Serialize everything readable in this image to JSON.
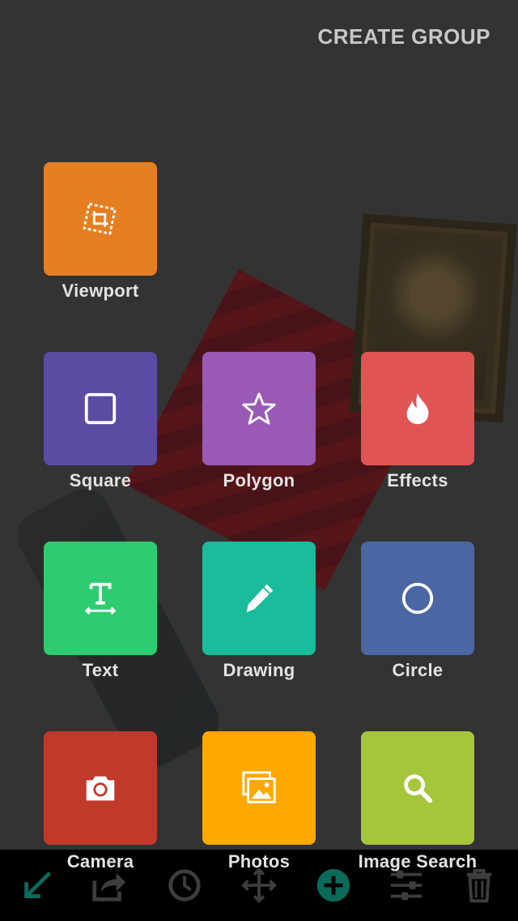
{
  "header": {
    "title": "CREATE GROUP"
  },
  "menu": {
    "items": [
      {
        "label": "Viewport",
        "icon": "crop-icon",
        "color": "#E67E22"
      },
      {
        "label": "Square",
        "icon": "square-icon",
        "color": "#5B4BA3"
      },
      {
        "label": "Polygon",
        "icon": "star-icon",
        "color": "#9B59B6"
      },
      {
        "label": "Effects",
        "icon": "fire-icon",
        "color": "#E05454"
      },
      {
        "label": "Text",
        "icon": "text-icon",
        "color": "#2ECC71"
      },
      {
        "label": "Drawing",
        "icon": "pencil-icon",
        "color": "#1ABC9C"
      },
      {
        "label": "Circle",
        "icon": "circle-icon",
        "color": "#4A67A3"
      },
      {
        "label": "Camera",
        "icon": "camera-icon",
        "color": "#C0392B"
      },
      {
        "label": "Photos",
        "icon": "photos-icon",
        "color": "#FFA800"
      },
      {
        "label": "Image Search",
        "icon": "search-icon",
        "color": "#A5C63B"
      }
    ]
  },
  "toolbar": {
    "icons": [
      "back-arrow-icon",
      "share-icon",
      "history-icon",
      "move-icon",
      "add-icon",
      "sliders-icon",
      "trash-icon"
    ],
    "accent": "#0B6B5A",
    "dim": "#3d3d3d"
  }
}
